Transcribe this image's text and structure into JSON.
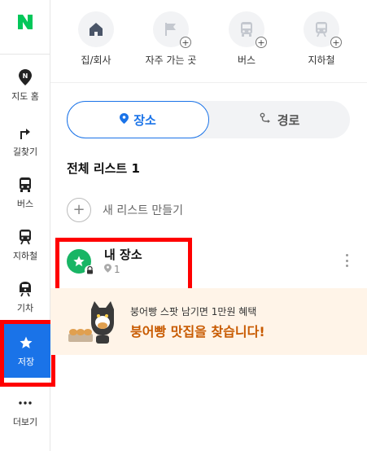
{
  "app": {
    "logo_text": "N"
  },
  "rail": {
    "items": [
      {
        "label": "지도 홈",
        "icon": "map-pin-icon"
      },
      {
        "label": "길찾기",
        "icon": "directions-arrow-icon"
      },
      {
        "label": "버스",
        "icon": "bus-icon"
      },
      {
        "label": "지하철",
        "icon": "subway-icon"
      },
      {
        "label": "기차",
        "icon": "train-icon"
      },
      {
        "label": "저장",
        "icon": "star-icon",
        "active": true
      },
      {
        "label": "더보기",
        "icon": "more-dots-icon"
      }
    ]
  },
  "categories": [
    {
      "label": "집/회사",
      "icon": "home-icon"
    },
    {
      "label": "자주 가는 곳",
      "icon": "flag-icon",
      "plus": "+"
    },
    {
      "label": "버스",
      "icon": "bus-icon",
      "plus": "+"
    },
    {
      "label": "지하철",
      "icon": "subway-icon",
      "plus": "+"
    }
  ],
  "tabs": {
    "places": "장소",
    "routes": "경로"
  },
  "list_header": "전체 리스트 1",
  "new_list": {
    "plus": "+",
    "label": "새 리스트 만들기"
  },
  "saved_list": {
    "name": "내 장소",
    "count": "1"
  },
  "banner": {
    "sub": "붕어빵 스팟 남기면 1만원 혜택",
    "main": "붕어빵 맛집을 찾습니다!"
  },
  "colors": {
    "accent": "#1a73e8",
    "brand_green": "#03c75a",
    "place_green": "#19b565",
    "banner_bg": "#fff4e8",
    "banner_text": "#c85a00",
    "highlight": "#ff0000"
  }
}
